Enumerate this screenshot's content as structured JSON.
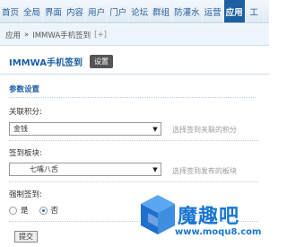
{
  "topnav": {
    "items": [
      "首页",
      "全局",
      "界面",
      "内容",
      "用户",
      "门户",
      "论坛",
      "群组",
      "防灌水",
      "运营",
      "应用",
      "工"
    ],
    "active_index": 10
  },
  "breadcrumb": {
    "root": "应用",
    "sep": "»",
    "page": "IMMWA手机签到",
    "plus": "[+]"
  },
  "plugin": {
    "title": "IMMWA手机签到",
    "settings_label": "设置"
  },
  "section": {
    "header": "参数设置"
  },
  "fields": {
    "points": {
      "label": "关联积分:",
      "value": "金钱",
      "hint": "选择签到关联的积分"
    },
    "forum": {
      "label": "签到板块:",
      "value": "七嘴八舌",
      "hint": "选择签到发布的板块"
    },
    "forced": {
      "label": "强制签到:",
      "options": [
        "是",
        "否"
      ],
      "selected": "否"
    }
  },
  "submit_label": "提交",
  "watermark": {
    "brand": "魔趣吧",
    "url": "www.moqu8.com"
  },
  "colors": {
    "accent": "#1c5fa3",
    "watermark": "#1976d2"
  }
}
